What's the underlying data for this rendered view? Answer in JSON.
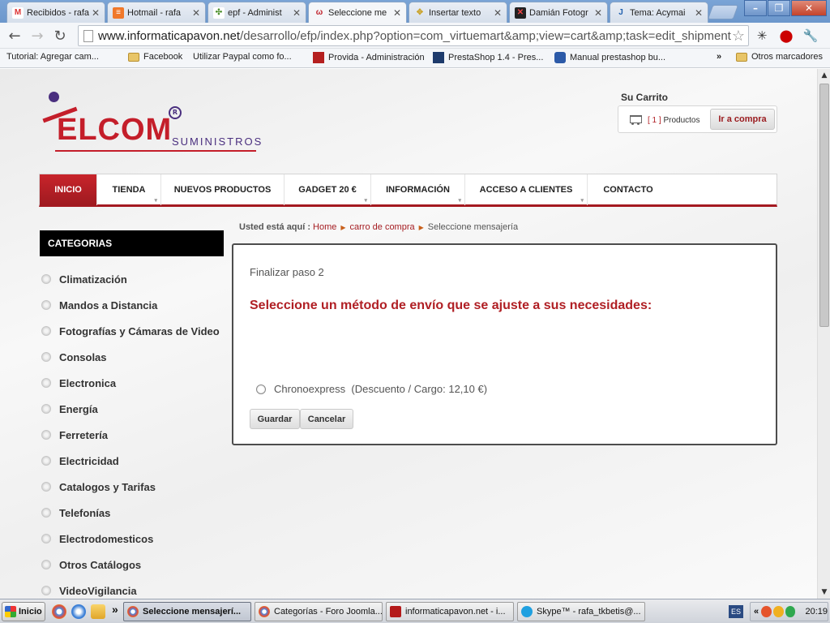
{
  "browser": {
    "tabs": [
      {
        "label": "Recibidos - rafa",
        "icon": "gmail-icon"
      },
      {
        "label": "Hotmail - rafa",
        "icon": "hotmail-icon"
      },
      {
        "label": "epf - Administ",
        "icon": "joomla-icon"
      },
      {
        "label": "Seleccione me",
        "icon": "site-favicon-icon"
      },
      {
        "label": "Insertar texto",
        "icon": "page-icon"
      },
      {
        "label": "Damián Fotogr",
        "icon": "xbox-icon"
      },
      {
        "label": "Tema: Acymai",
        "icon": "joomla-forum-icon"
      }
    ],
    "tab_close": "✕",
    "window_buttons": {
      "minimize": "–",
      "restore": "❐",
      "close": "✕"
    },
    "url": {
      "host": "www.informaticapavon.net",
      "path": "/desarrollo/efp/index.php?option=com_virtuemart&amp;view=cart&amp;task=edit_shipment"
    },
    "bookmarks": [
      {
        "label": "Tutorial: Agregar cam...",
        "icon": "page-icon"
      },
      {
        "label": "Facebook",
        "icon": "folder-icon"
      },
      {
        "label": "Utilizar Paypal como fo...",
        "icon": "page-icon"
      },
      {
        "label": "Provida - Administración",
        "icon": "provida-icon"
      },
      {
        "label": "PrestaShop 1.4 - Pres...",
        "icon": "prestashop-icon"
      },
      {
        "label": "Manual prestashop bu...",
        "icon": "s-icon"
      }
    ],
    "bookmarks_more": "»",
    "other_bookmarks": "Otros marcadores"
  },
  "site": {
    "logo": {
      "main": "ELCOM",
      "sub": "SUMINISTROS",
      "reg": "R"
    },
    "cart": {
      "title": "Su Carrito",
      "count": "[ 1 ]",
      "count_label": "Productos",
      "buy_button": "Ir a compra"
    },
    "nav": [
      {
        "label": "INICIO",
        "active": true
      },
      {
        "label": "TIENDA"
      },
      {
        "label": "NUEVOS PRODUCTOS"
      },
      {
        "label": "GADGET 20 €"
      },
      {
        "label": "INFORMACIÓN"
      },
      {
        "label": "ACCESO A CLIENTES"
      },
      {
        "label": "CONTACTO"
      }
    ],
    "sidebar": {
      "title": "CATEGORIAS",
      "items": [
        "Climatización",
        "Mandos a Distancia",
        "Fotografías y Cámaras de Video",
        "Consolas",
        "Electronica",
        "Energía",
        "Ferretería",
        "Electricidad",
        "Catalogos y Tarifas",
        "Telefonías",
        "Electrodomesticos",
        "Otros Catálogos",
        "VideoVigilancia"
      ]
    },
    "breadcrumb": {
      "prefix": "Usted está aquí :",
      "items": [
        "Home",
        "carro de compra",
        "Seleccione mensajería"
      ]
    },
    "checkout": {
      "step": "Finalizar paso 2",
      "heading": "Seleccione un método de envío que se ajuste a sus necesidades:",
      "option_name": "Chronoexpress",
      "option_detail": "(Descuento / Cargo: 12,10 €)",
      "save_button": "Guardar",
      "cancel_button": "Cancelar"
    }
  },
  "taskbar": {
    "start": "Inicio",
    "tasks": [
      {
        "label": "Seleccione mensajerí...",
        "active": true
      },
      {
        "label": "Categorías - Foro Joomla..."
      },
      {
        "label": "informaticapavon.net - i..."
      },
      {
        "label": "Skype™ - rafa_tkbetis@..."
      }
    ],
    "language": "ES",
    "clock": "20:19",
    "chevron": "»"
  },
  "colors": {
    "brand_red": "#b01f24",
    "nav_red": "#a41920",
    "logo_purple": "#4a2f7f"
  }
}
